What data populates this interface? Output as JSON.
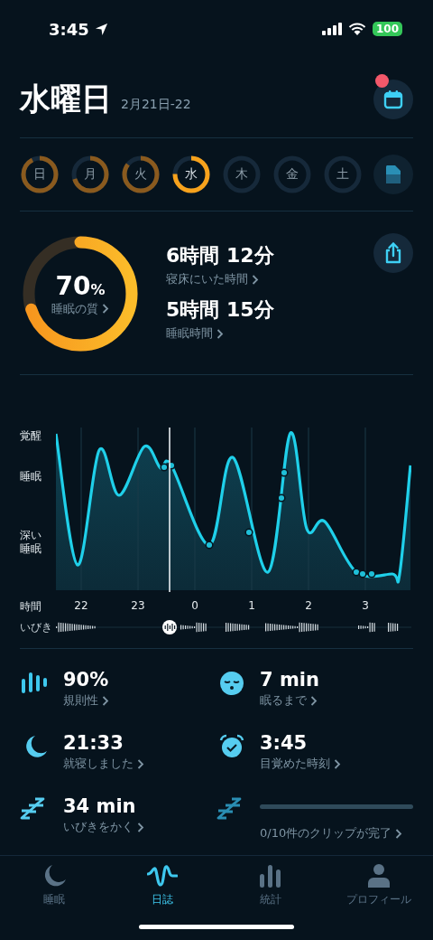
{
  "status_bar": {
    "time": "3:45",
    "battery": "100"
  },
  "header": {
    "title": "水曜日",
    "date": "2月21日-22",
    "notification_dot": true
  },
  "days": [
    {
      "label": "日",
      "level": 0.92,
      "selected": false
    },
    {
      "label": "月",
      "level": 0.7,
      "selected": false
    },
    {
      "label": "火",
      "level": 0.85,
      "selected": false
    },
    {
      "label": "水",
      "level": 0.75,
      "selected": true
    },
    {
      "label": "木",
      "selected": false
    },
    {
      "label": "金",
      "selected": false
    },
    {
      "label": "土",
      "selected": false
    }
  ],
  "summary": {
    "quality": {
      "value": "70",
      "unit": "%",
      "label": "睡眠の質",
      "level": 0.7
    },
    "durations": [
      {
        "value": "6時間 12分",
        "label": "寝床にいた時間"
      },
      {
        "value": "5時間 15分",
        "label": "睡眠時間"
      }
    ]
  },
  "hypnogram": {
    "stages": [
      "覚醒",
      "睡眠",
      "深い睡眠"
    ],
    "time_label": "時間",
    "hours": [
      "22",
      "23",
      "0",
      "1",
      "2",
      "3"
    ],
    "snore_label": "いびき"
  },
  "stats": [
    {
      "kind": "regularity",
      "value": "90%",
      "label": "規則性"
    },
    {
      "kind": "latency",
      "value": "7 min",
      "label": "眠るまで"
    },
    {
      "kind": "bedtime",
      "value": "21:33",
      "label": "就寝しました"
    },
    {
      "kind": "wake",
      "value": "3:45",
      "label": "目覚めた時刻"
    },
    {
      "kind": "snoring",
      "value": "34 min",
      "label": "いびきをかく"
    },
    {
      "kind": "clips",
      "level": 0,
      "label": "0/10件のクリップが完了"
    }
  ],
  "tabs": [
    {
      "label": "睡眠",
      "selected": false
    },
    {
      "label": "日誌",
      "selected": true
    },
    {
      "label": "統計",
      "selected": false
    },
    {
      "label": "プロフィール",
      "selected": false
    }
  ]
}
